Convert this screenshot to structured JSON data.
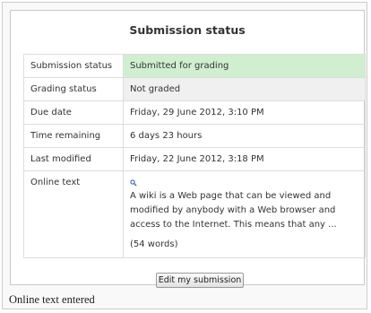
{
  "submission_status": {
    "title": "Submission status",
    "rows": [
      {
        "label": "Submission status",
        "value": "Submitted for grading"
      },
      {
        "label": "Grading status",
        "value": "Not graded"
      },
      {
        "label": "Due date",
        "value": "Friday, 29 June 2012, 3:10 PM"
      },
      {
        "label": "Time remaining",
        "value": "6 days 23 hours"
      },
      {
        "label": "Last modified",
        "value": "Friday, 22 June 2012, 3:18 PM"
      }
    ],
    "online_text": {
      "label": "Online text",
      "icon": "magnifier-icon",
      "text": "A wiki is a Web page that can be viewed and modified by anybody with a Web browser and access to the Internet. This means  that any ...",
      "word_count": "(54 words)"
    },
    "edit_button_label": "Edit my submission"
  },
  "caption": "Online text entered",
  "colors": {
    "submitted_bg": "#cfefcf",
    "not_graded_bg": "#f0f0f0",
    "border": "#dddddd"
  }
}
